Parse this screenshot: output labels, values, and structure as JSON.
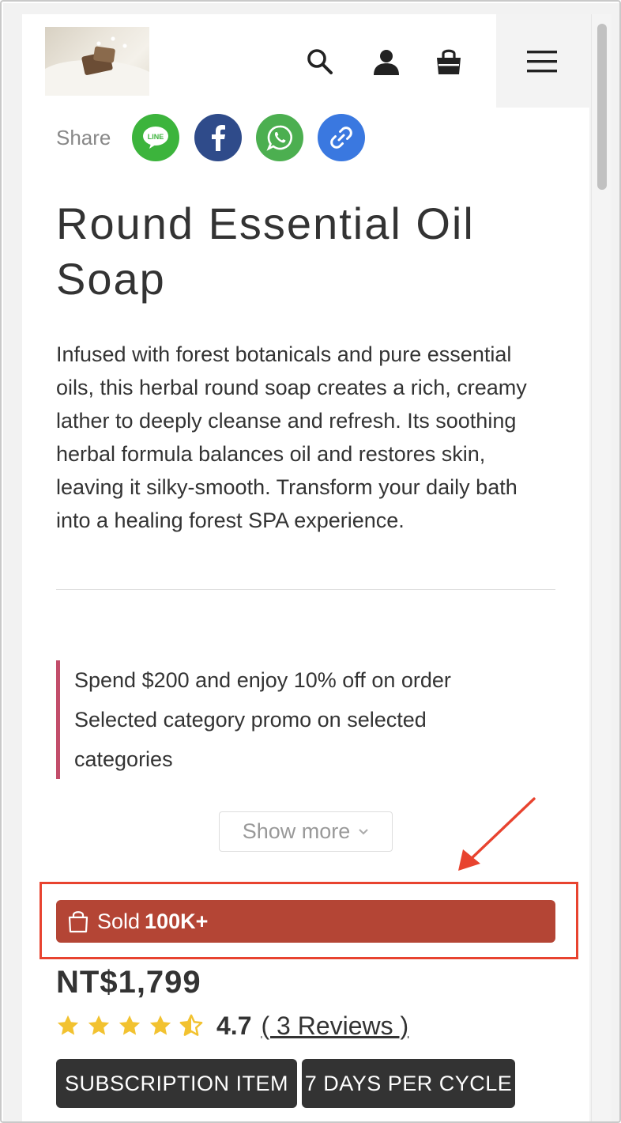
{
  "header": {
    "logo_alt": "Soap store logo",
    "icons": [
      "search-icon",
      "user-icon",
      "cart-bag-icon",
      "hamburger-menu-icon"
    ]
  },
  "share": {
    "label": "Share",
    "buttons": [
      {
        "name": "LINE",
        "color": "#3cb43c",
        "glyph": "LINE"
      },
      {
        "name": "Facebook",
        "color": "#2f4b8a",
        "glyph": "f"
      },
      {
        "name": "WhatsApp",
        "color": "#4caf50",
        "glyph": "whatsapp"
      },
      {
        "name": "Copy link",
        "color": "#3a78e0",
        "glyph": "link"
      }
    ]
  },
  "product": {
    "title": "Round Essential Oil Soap",
    "description": "Infused with forest botanicals and pure essential oils, this herbal round soap creates a rich, creamy lather to deeply cleanse and refresh. Its soothing herbal formula balances oil and restores skin, leaving it silky-smooth. Transform your daily bath into a healing forest SPA experience.",
    "price": "NT$1,799",
    "rating_value": "4.7",
    "rating_stars": 4.5,
    "reviews_label": "( 3 Reviews )"
  },
  "promo": {
    "line1": "Spend $200 and enjoy 10% off on order",
    "line2": "Selected category promo on selected categories",
    "accent_color": "#c24d6a"
  },
  "show_more": {
    "label": "Show more"
  },
  "sold": {
    "prefix": "Sold",
    "count": "100K+",
    "bg_color": "#b44535"
  },
  "tags": [
    "SUBSCRIPTION ITEM",
    "7 DAYS PER CYCLE"
  ],
  "annotation": {
    "color": "#e8432f"
  }
}
